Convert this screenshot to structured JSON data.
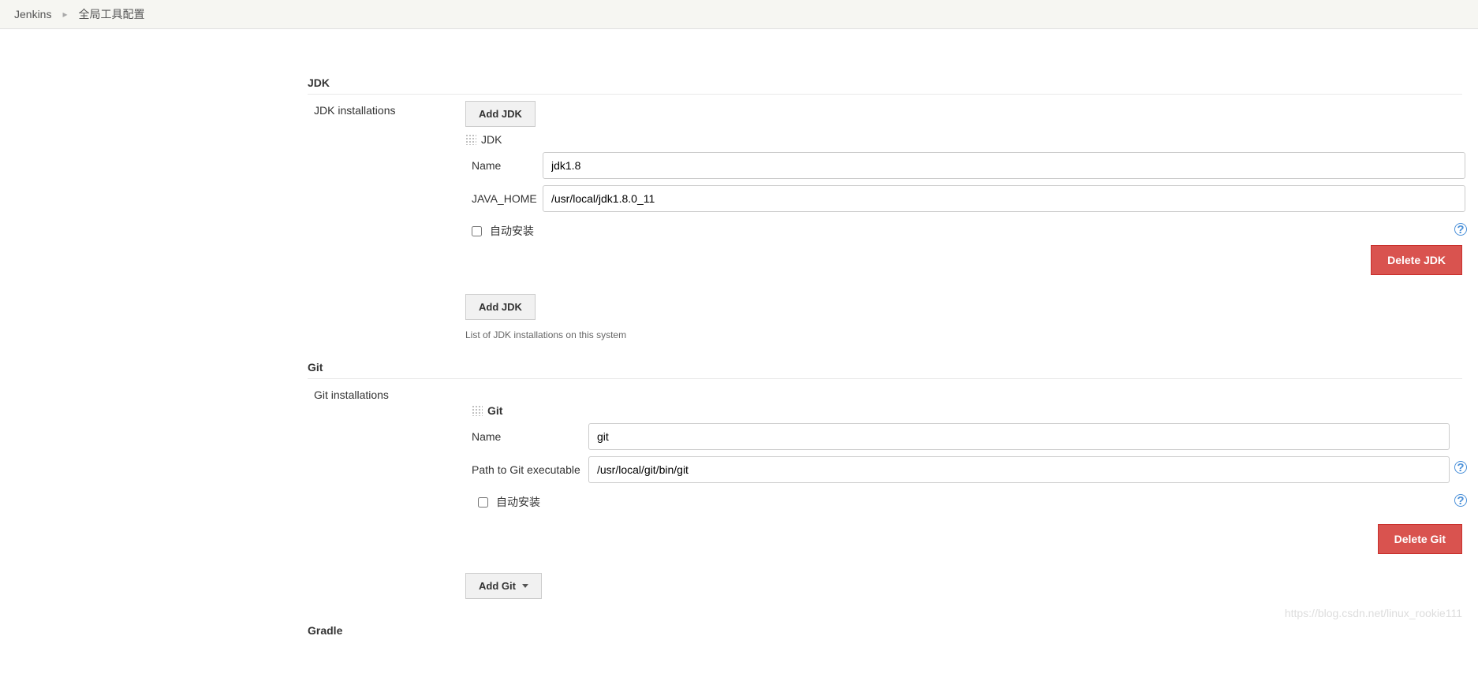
{
  "breadcrumb": {
    "root": "Jenkins",
    "page": "全局工具配置"
  },
  "sections": {
    "jdk": {
      "title": "JDK",
      "installations_label": "JDK installations",
      "add_btn": "Add JDK",
      "inst_header": "JDK",
      "name_label": "Name",
      "name_value": "jdk1.8",
      "home_label": "JAVA_HOME",
      "home_value": "/usr/local/jdk1.8.0_11",
      "auto_install": "自动安装",
      "delete_btn": "Delete JDK",
      "add_btn2": "Add JDK",
      "hint": "List of JDK installations on this system"
    },
    "git": {
      "title": "Git",
      "installations_label": "Git installations",
      "inst_header": "Git",
      "name_label": "Name",
      "name_value": "git",
      "path_label": "Path to Git executable",
      "path_value": "/usr/local/git/bin/git",
      "auto_install": "自动安装",
      "delete_btn": "Delete Git",
      "add_btn": "Add Git"
    },
    "gradle": {
      "title": "Gradle"
    }
  },
  "watermark": "https://blog.csdn.net/linux_rookie111"
}
